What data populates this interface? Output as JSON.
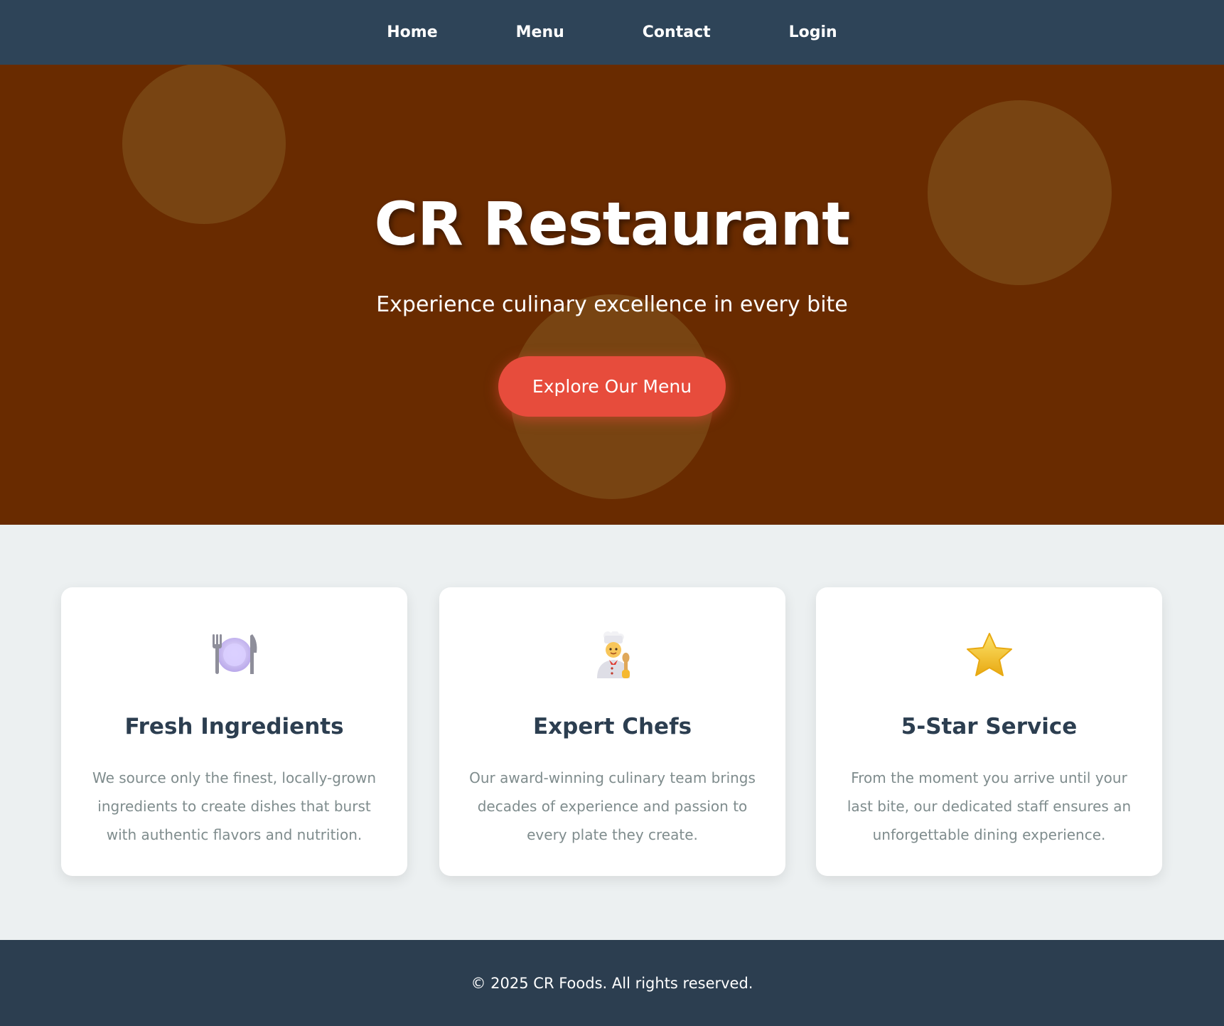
{
  "nav": {
    "items": [
      {
        "label": "Home"
      },
      {
        "label": "Menu"
      },
      {
        "label": "Contact"
      },
      {
        "label": "Login"
      }
    ]
  },
  "hero": {
    "title": "CR Restaurant",
    "subtitle": "Experience culinary excellence in every bite",
    "cta_label": "Explore Our Menu"
  },
  "features": [
    {
      "icon": "plate-with-cutlery-icon",
      "title": "Fresh Ingredients",
      "text": "We source only the finest, locally-grown ingredients to create dishes that burst with authentic flavors and nutrition."
    },
    {
      "icon": "chef-icon",
      "title": "Expert Chefs",
      "text": "Our award-winning culinary team brings decades of experience and passion to every plate they create."
    },
    {
      "icon": "star-icon",
      "title": "5-Star Service",
      "text": "From the moment you arrive until your last bite, our dedicated staff ensures an unforgettable dining experience."
    }
  ],
  "footer": {
    "text": "© 2025 CR Foods. All rights reserved."
  },
  "colors": {
    "nav_bg": "#2e4458",
    "hero_bg": "#692b00",
    "accent": "#e74c3c",
    "section_bg": "#ecf0f1",
    "footer_bg": "#2c3e50",
    "heading": "#2c3e50",
    "body_text": "#7f8c8d"
  }
}
